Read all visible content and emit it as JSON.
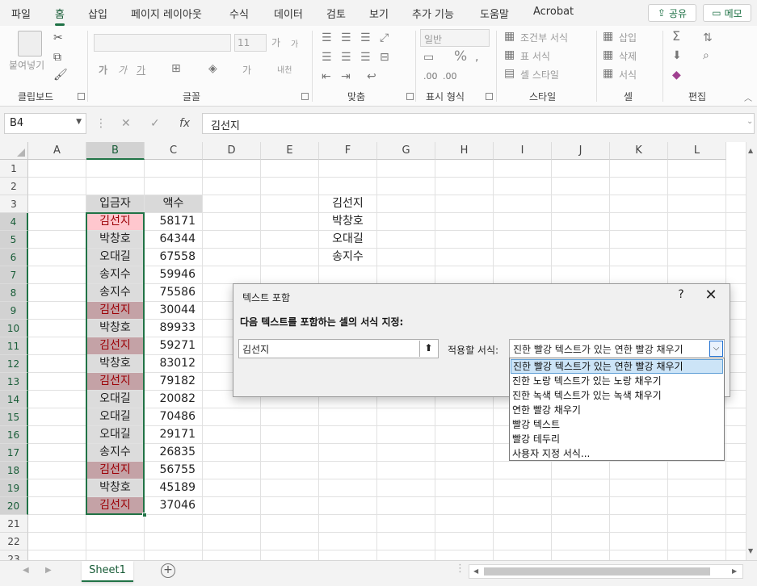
{
  "ribbon_tabs": [
    "파일",
    "홈",
    "삽입",
    "페이지 레이아웃",
    "수식",
    "데이터",
    "검토",
    "보기",
    "추가 기능",
    "도움말",
    "Acrobat"
  ],
  "active_tab": "홈",
  "share_label": "공유",
  "memo_label": "메모",
  "ribbon_groups": {
    "clipboard": "클립보드",
    "font": "글꼴",
    "alignment": "맞춤",
    "number": "표시 형식",
    "styles": "스타일",
    "cells": "셀",
    "editing": "편집"
  },
  "ribbon_labels": {
    "paste": "붙여넣기",
    "font_size": "11",
    "number_format": "일반",
    "conditional_format": "조건부 서식",
    "format_as_table": "표 서식",
    "cell_styles": "셀 스타일",
    "insert": "삽입",
    "delete": "삭제",
    "format": "서식",
    "bold": "가",
    "italic": "가",
    "underline": "가",
    "grow_font": "가",
    "shrink_font": "가",
    "phonetic": "내천",
    "percent": "%"
  },
  "name_box": "B4",
  "formula_value": "김선지",
  "columns": [
    "A",
    "B",
    "C",
    "D",
    "E",
    "F",
    "G",
    "H",
    "I",
    "J",
    "K",
    "L"
  ],
  "selected_column": "B",
  "rows": [
    "1",
    "2",
    "3",
    "4",
    "5",
    "6",
    "7",
    "8",
    "9",
    "10",
    "11",
    "12",
    "13",
    "14",
    "15",
    "16",
    "17",
    "18",
    "19",
    "20",
    "21",
    "22",
    "23"
  ],
  "table_headers": {
    "b3": "입금자",
    "c3": "액수"
  },
  "table_rows": [
    {
      "name": "김선지",
      "amount": "58171"
    },
    {
      "name": "박창호",
      "amount": "64344"
    },
    {
      "name": "오대길",
      "amount": "67558"
    },
    {
      "name": "송지수",
      "amount": "59946"
    },
    {
      "name": "송지수",
      "amount": "75586"
    },
    {
      "name": "김선지",
      "amount": "30044"
    },
    {
      "name": "박창호",
      "amount": "89933"
    },
    {
      "name": "김선지",
      "amount": "59271"
    },
    {
      "name": "박창호",
      "amount": "83012"
    },
    {
      "name": "김선지",
      "amount": "79182"
    },
    {
      "name": "오대길",
      "amount": "20082"
    },
    {
      "name": "오대길",
      "amount": "70486"
    },
    {
      "name": "오대길",
      "amount": "29171"
    },
    {
      "name": "송지수",
      "amount": "26835"
    },
    {
      "name": "김선지",
      "amount": "56755"
    },
    {
      "name": "박창호",
      "amount": "45189"
    },
    {
      "name": "김선지",
      "amount": "37046"
    }
  ],
  "f_column": [
    "김선지",
    "박창호",
    "오대길",
    "송지수"
  ],
  "sheet_tab": "Sheet1",
  "dialog": {
    "title": "텍스트 포함",
    "help": "?",
    "close": "✕",
    "prompt": "다음 텍스트를 포함하는 셀의 서식 지정:",
    "input_value": "김선지",
    "format_label": "적용할 서식:",
    "selected_format": "진한 빨강 텍스트가 있는 연한 빨강 채우기",
    "options": [
      "진한 빨강 텍스트가 있는 연한 빨강 채우기",
      "진한 노랑 텍스트가 있는 노랑 채우기",
      "진한 녹색 텍스트가 있는 녹색 채우기",
      "연한 빨강 채우기",
      "빨강 텍스트",
      "빨강 테두리",
      "사용자 지정 서식..."
    ]
  },
  "colors": {
    "accent": "#217346",
    "cf_fill": "#ffc7ce",
    "cf_text": "#9c0006"
  }
}
